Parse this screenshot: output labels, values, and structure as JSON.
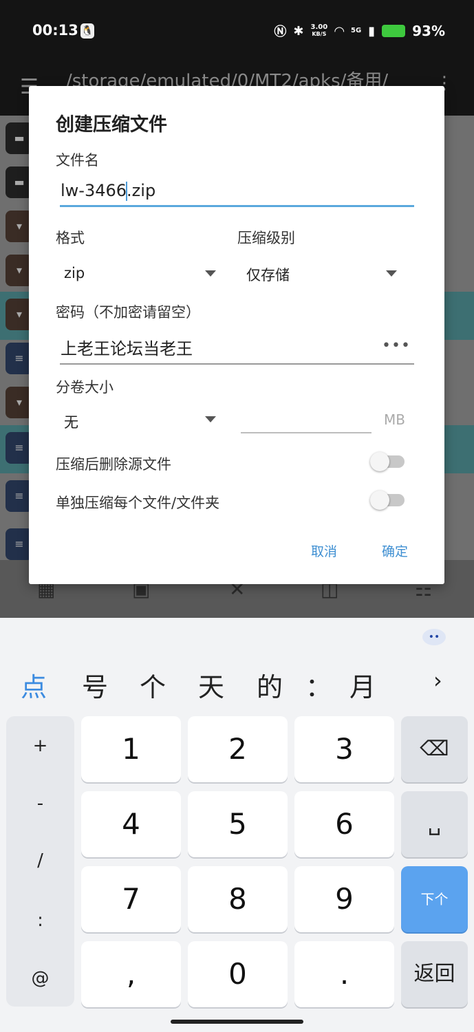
{
  "status_bar": {
    "time": "00:13",
    "net_speed_value": "3.00",
    "net_speed_unit": "KB/S",
    "signal": "5G",
    "battery": "93%",
    "battery_color": "#3ec93e"
  },
  "app_bar": {
    "path": "/storage/emulated/0/MT2/apks/备用/"
  },
  "dialog": {
    "title": "创建压缩文件",
    "filename_label": "文件名",
    "filename_before_caret": "lw-3466",
    "filename_after_caret": ".zip",
    "format_label": "格式",
    "format_value": "zip",
    "level_label": "压缩级别",
    "level_value": "仅存储",
    "password_label": "密码（不加密请留空）",
    "password_value": "上老王论坛当老王",
    "password_toggle": "•••",
    "volume_label": "分卷大小",
    "volume_value": "无",
    "volume_size_value": "",
    "volume_unit": "MB",
    "delete_source_label": "压缩后删除源文件",
    "delete_source_on": false,
    "separate_label": "单独压缩每个文件/文件夹",
    "separate_on": false,
    "cancel": "取消",
    "ok": "确定",
    "accent": "#3f8fd2"
  },
  "keyboard": {
    "candidates": [
      "点",
      "号",
      "个",
      "天",
      "的",
      "：",
      "月"
    ],
    "candidate_more": "›",
    "symbols": [
      "+",
      "-",
      "/",
      ":",
      "@"
    ],
    "digits_row1": [
      "1",
      "2",
      "3"
    ],
    "digits_row2": [
      "4",
      "5",
      "6"
    ],
    "digits_row3": [
      "7",
      "8",
      "9"
    ],
    "digits_row4": [
      ",",
      "0",
      "."
    ],
    "backspace": "⌫",
    "space": "␣",
    "next": "下个",
    "back": "返回",
    "next_color": "#5ba3ef"
  }
}
